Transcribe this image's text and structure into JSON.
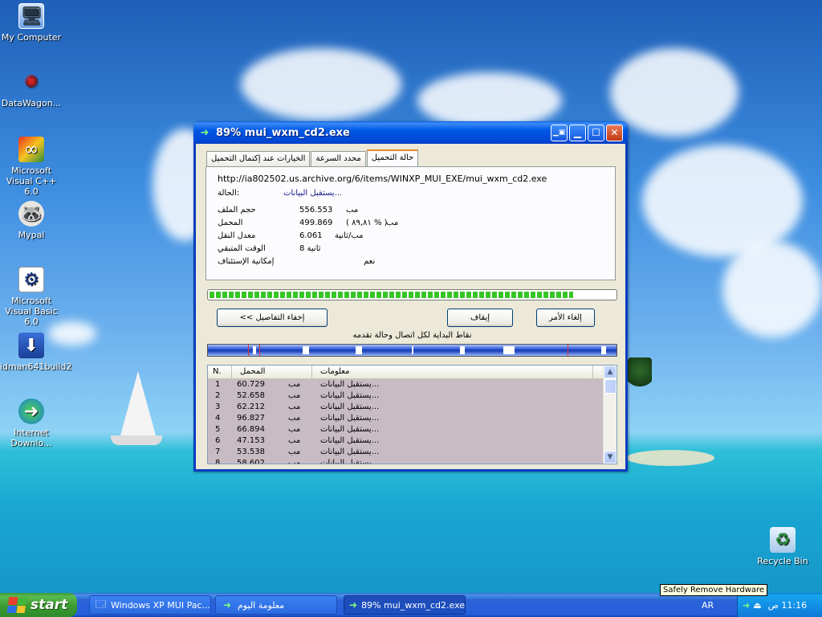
{
  "desktop": {
    "icons": [
      {
        "label": "My Computer",
        "icon": "computer-icon"
      },
      {
        "label": "DataWagon...",
        "icon": "datawagon-icon"
      },
      {
        "label": "Microsoft Visual C++ 6.0",
        "icon": "visual-cpp-icon"
      },
      {
        "label": "Mypal",
        "icon": "mypal-icon"
      },
      {
        "label": "Microsoft Visual Basic 6.0",
        "icon": "visual-basic-icon"
      },
      {
        "label": "idman641build2",
        "icon": "installer-icon"
      },
      {
        "label": "Internet Downlo...",
        "icon": "idm-icon"
      },
      {
        "label": "Recycle Bin",
        "icon": "recycle-bin-icon"
      }
    ]
  },
  "window": {
    "title": "89% mui_wxm_cd2.exe",
    "tabs": [
      {
        "label": "حالة التحميل",
        "active": true
      },
      {
        "label": "محدد السرعة",
        "active": false
      },
      {
        "label": "الخيارات عند إكتمال التحميل",
        "active": false
      }
    ],
    "url": "http://ia802502.us.archive.org/6/items/WINXP_MUI_EXE/mui_wxm_cd2.exe",
    "status_label": "الحالة:",
    "status_value": "يستقبل البيانات...",
    "fields": {
      "size_label": "حجم الملف",
      "size_value": "556.553",
      "size_unit": "مب",
      "downloaded_label": "المحمل",
      "downloaded_value": "499.869",
      "downloaded_unit": "مب",
      "downloaded_pct": "( ٨٩,٨١ % )",
      "rate_label": "معدل النقل",
      "rate_value": "6.061",
      "rate_unit": "مب/ثانية",
      "remaining_label": "الوقت المتبقي",
      "remaining_value": "8 ثانية",
      "resume_label": "إمكانية الإستئناف",
      "resume_value": "نعم"
    },
    "progress": 0.898,
    "buttons": {
      "hide_details": "<< إخفاء التفاصيل",
      "pause": "إيقاف",
      "cancel": "إلغاء الأمر"
    },
    "segments_label": "نقاط البداية لكل اتصال وحالة تقدمه",
    "list": {
      "headers": {
        "n": "N.",
        "downloaded": "المحمل",
        "info": "معلومات"
      },
      "rows": [
        {
          "n": "1",
          "size": "60.729",
          "unit": "مب",
          "info": "يستقبل البيانات..."
        },
        {
          "n": "2",
          "size": "52.658",
          "unit": "مب",
          "info": "يستقبل البيانات..."
        },
        {
          "n": "3",
          "size": "62.212",
          "unit": "مب",
          "info": "يستقبل البيانات..."
        },
        {
          "n": "4",
          "size": "96.827",
          "unit": "مب",
          "info": "يستقبل البيانات..."
        },
        {
          "n": "5",
          "size": "66.894",
          "unit": "مب",
          "info": "يستقبل البيانات..."
        },
        {
          "n": "6",
          "size": "47.153",
          "unit": "مب",
          "info": "يستقبل البيانات..."
        },
        {
          "n": "7",
          "size": "53.538",
          "unit": "مب",
          "info": "يستقبل البيانات..."
        },
        {
          "n": "8",
          "size": "58.602",
          "unit": "مب",
          "info": "يستقبل البيانات..."
        }
      ]
    }
  },
  "taskbar": {
    "start": "start",
    "tasks": [
      {
        "label": "Windows XP MUI Pac...",
        "active": false
      },
      {
        "label": "معلومة اليوم",
        "active": false
      },
      {
        "label": "89% mui_wxm_cd2.exe",
        "active": true
      }
    ],
    "language": "AR",
    "clock": "11:16 ص"
  },
  "tooltip": "Safely Remove Hardware"
}
